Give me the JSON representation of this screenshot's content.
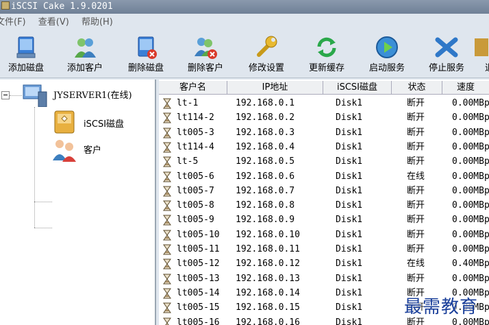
{
  "window": {
    "title": "iSCSI Cake 1.9.0201"
  },
  "menu": [
    "文件(F)",
    "查看(V)",
    "帮助(H)"
  ],
  "toolbar": [
    {
      "label": "添加磁盘",
      "icon": "disk-add-icon"
    },
    {
      "label": "添加客户",
      "icon": "user-add-icon"
    },
    {
      "label": "删除磁盘",
      "icon": "disk-delete-icon"
    },
    {
      "label": "删除客户",
      "icon": "user-delete-icon"
    },
    {
      "label": "修改设置",
      "icon": "wrench-icon"
    },
    {
      "label": "更新缓存",
      "icon": "refresh-icon"
    },
    {
      "label": "启动服务",
      "icon": "play-icon"
    },
    {
      "label": "停止服务",
      "icon": "stop-icon"
    },
    {
      "label": "退",
      "icon": "exit-icon"
    }
  ],
  "tree": {
    "server": "JYSERVER1(在线)",
    "disk": "iSCSI磁盘",
    "clients": "客户"
  },
  "table": {
    "columns": [
      "客户名",
      "IP地址",
      "iSCSI磁盘",
      "状态",
      "速度"
    ],
    "rows": [
      [
        "lt-1",
        "192.168.0.1",
        "Disk1",
        "断开",
        "0.00MBp"
      ],
      [
        "lt114-2",
        "192.168.0.2",
        "Disk1",
        "断开",
        "0.00MBp"
      ],
      [
        "lt005-3",
        "192.168.0.3",
        "Disk1",
        "断开",
        "0.00MBp"
      ],
      [
        "lt114-4",
        "192.168.0.4",
        "Disk1",
        "断开",
        "0.00MBp"
      ],
      [
        "lt-5",
        "192.168.0.5",
        "Disk1",
        "断开",
        "0.00MBp"
      ],
      [
        "lt005-6",
        "192.168.0.6",
        "Disk1",
        "在线",
        "0.00MBp"
      ],
      [
        "lt005-7",
        "192.168.0.7",
        "Disk1",
        "断开",
        "0.00MBp"
      ],
      [
        "lt005-8",
        "192.168.0.8",
        "Disk1",
        "断开",
        "0.00MBp"
      ],
      [
        "lt005-9",
        "192.168.0.9",
        "Disk1",
        "断开",
        "0.00MBp"
      ],
      [
        "lt005-10",
        "192.168.0.10",
        "Disk1",
        "断开",
        "0.00MBp"
      ],
      [
        "lt005-11",
        "192.168.0.11",
        "Disk1",
        "断开",
        "0.00MBp"
      ],
      [
        "lt005-12",
        "192.168.0.12",
        "Disk1",
        "在线",
        "0.40MBp"
      ],
      [
        "lt005-13",
        "192.168.0.13",
        "Disk1",
        "断开",
        "0.00MBp"
      ],
      [
        "lt005-14",
        "192.168.0.14",
        "Disk1",
        "断开",
        "0.00MBp"
      ],
      [
        "lt005-15",
        "192.168.0.15",
        "Disk1",
        "断开",
        "0.00MBp"
      ],
      [
        "lt005-16",
        "192.168.0.16",
        "Disk1",
        "断开",
        "0.00MBp"
      ]
    ]
  },
  "watermark": "最需教育"
}
